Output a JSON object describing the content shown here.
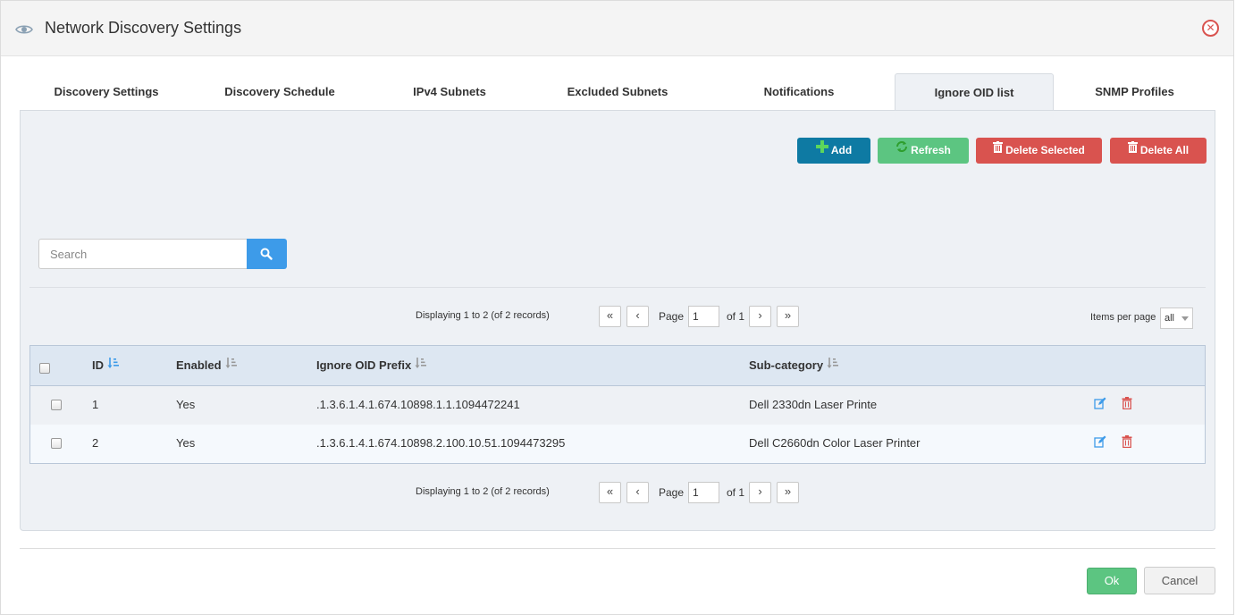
{
  "dialog": {
    "title": "Network Discovery Settings"
  },
  "tabs": [
    {
      "label": "Discovery Settings"
    },
    {
      "label": "Discovery Schedule"
    },
    {
      "label": "IPv4 Subnets"
    },
    {
      "label": "Excluded Subnets"
    },
    {
      "label": "Notifications"
    },
    {
      "label": "Ignore OID list",
      "active": true
    },
    {
      "label": "SNMP Profiles"
    }
  ],
  "toolbar": {
    "add_label": "Add",
    "refresh_label": "Refresh",
    "delete_selected_label": "Delete Selected",
    "delete_all_label": "Delete All"
  },
  "search": {
    "placeholder": "Search",
    "value": ""
  },
  "pager": {
    "display_text": "Displaying 1 to 2 (of 2 records)",
    "first": "«",
    "prev": "‹",
    "next": "›",
    "last": "»",
    "page_label": "Page",
    "page_value": "1",
    "of_label": "of 1",
    "items_per_page_label": "Items per page",
    "items_per_page_value": "all"
  },
  "table": {
    "columns": [
      "ID",
      "Enabled",
      "Ignore OID Prefix",
      "Sub-category"
    ],
    "rows": [
      {
        "id": "1",
        "enabled": "Yes",
        "prefix": ".1.3.6.1.4.1.674.10898.1.1.1094472241",
        "subcategory": "Dell 2330dn Laser Printe"
      },
      {
        "id": "2",
        "enabled": "Yes",
        "prefix": ".1.3.6.1.4.1.674.10898.2.100.10.51.1094473295",
        "subcategory": "Dell C2660dn Color Laser Printer"
      }
    ]
  },
  "footer": {
    "ok_label": "Ok",
    "cancel_label": "Cancel"
  },
  "colors": {
    "add": "#0e7aa3",
    "refresh": "#5cc581",
    "delete": "#d9534f",
    "search_button": "#3d9be9",
    "ok": "#5cc581"
  },
  "icons": {
    "header": "eye-icon",
    "close": "close-icon",
    "add": "plus-icon",
    "refresh": "refresh-icon",
    "delete": "trash-icon",
    "search": "search-icon",
    "sort": "sort-amount-icon",
    "edit": "edit-icon"
  }
}
